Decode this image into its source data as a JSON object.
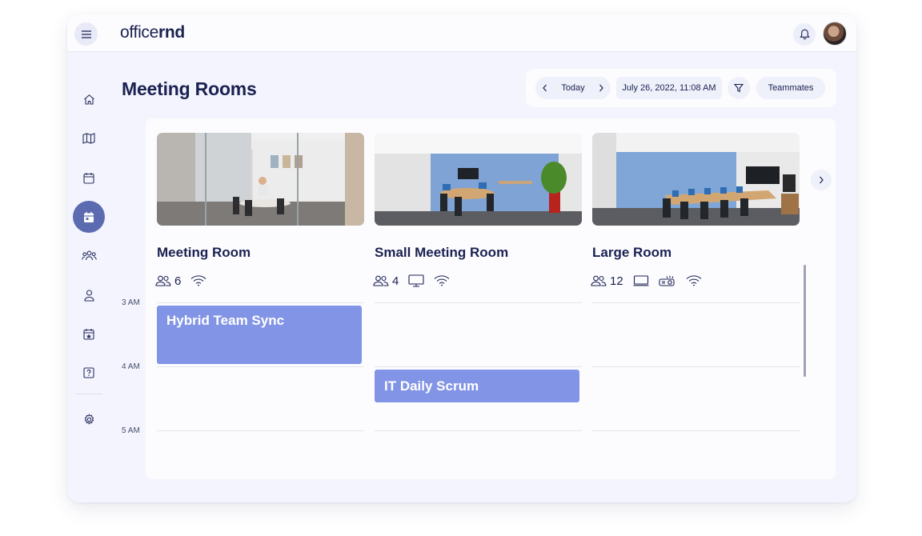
{
  "app": {
    "logo_prefix": "office",
    "logo_suffix": "rnd"
  },
  "page": {
    "title": "Meeting Rooms"
  },
  "toolbar": {
    "today": "Today",
    "date": "July 26, 2022, 11:08 AM",
    "teammates": "Teammates"
  },
  "sidebar": {
    "items": [
      {
        "icon": "home-icon"
      },
      {
        "icon": "map-icon"
      },
      {
        "icon": "calendar-icon"
      },
      {
        "icon": "calendar-booking-icon",
        "active": true
      },
      {
        "icon": "community-icon"
      },
      {
        "icon": "profile-icon"
      },
      {
        "icon": "events-icon"
      },
      {
        "icon": "help-icon"
      },
      {
        "icon": "settings-icon"
      }
    ]
  },
  "rooms": [
    {
      "name": "Meeting Room",
      "capacity": "6",
      "amenities": [
        "wifi-icon"
      ]
    },
    {
      "name": "Small Meeting Room",
      "capacity": "4",
      "amenities": [
        "monitor-icon",
        "wifi-icon"
      ]
    },
    {
      "name": "Large Room",
      "capacity": "12",
      "amenities": [
        "tv-icon",
        "projector-icon",
        "wifi-icon"
      ]
    }
  ],
  "times": [
    "3 AM",
    "4 AM",
    "5 AM"
  ],
  "events": [
    {
      "title": "Hybrid Team Sync",
      "room": "Meeting Room"
    },
    {
      "title": "IT Daily Scrum",
      "room": "Small Meeting Room"
    }
  ],
  "colors": {
    "accent": "#5c6ab0",
    "event": "#8294e6",
    "text": "#1b2150",
    "background": "#f3f4fd"
  }
}
